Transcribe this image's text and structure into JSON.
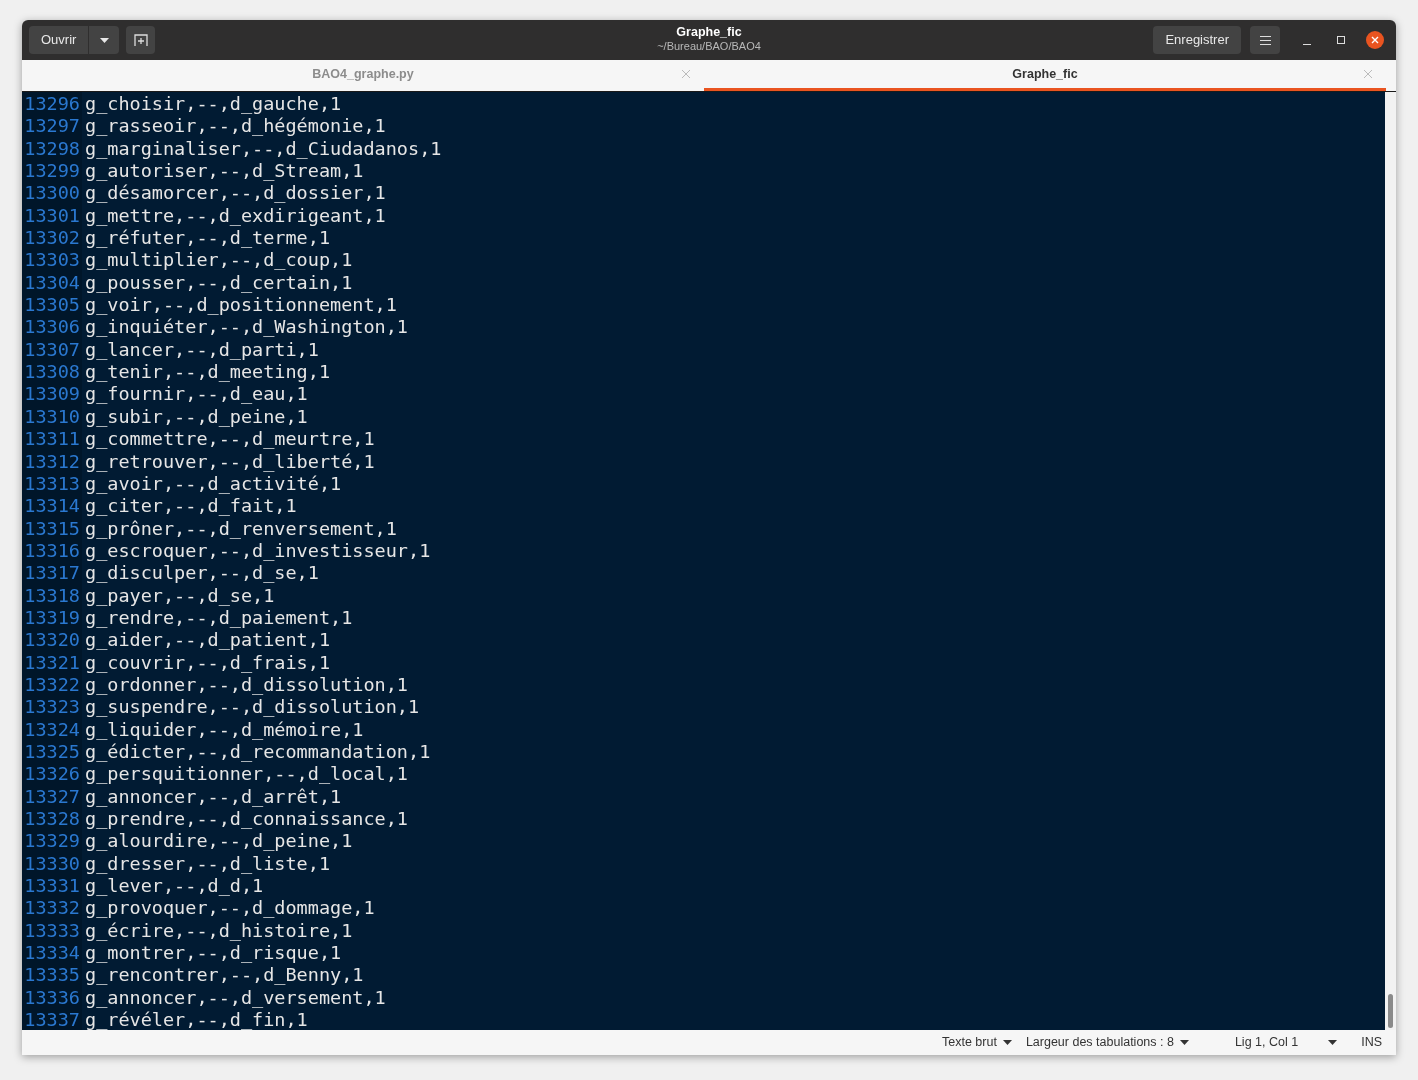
{
  "header": {
    "open_button": "Ouvrir",
    "title": "Graphe_fic",
    "subtitle": "~/Bureau/BAO/BAO4",
    "save_button": "Enregistrer"
  },
  "tabs": [
    {
      "label": "BAO4_graphe.py",
      "selected": false
    },
    {
      "label": "Graphe_fic",
      "selected": true
    }
  ],
  "lines": [
    {
      "number": "13296",
      "text": "g_choisir,--,d_gauche,1"
    },
    {
      "number": "13297",
      "text": "g_rasseoir,--,d_hégémonie,1"
    },
    {
      "number": "13298",
      "text": "g_marginaliser,--,d_Ciudadanos,1"
    },
    {
      "number": "13299",
      "text": "g_autoriser,--,d_Stream,1"
    },
    {
      "number": "13300",
      "text": "g_désamorcer,--,d_dossier,1"
    },
    {
      "number": "13301",
      "text": "g_mettre,--,d_exdirigeant,1"
    },
    {
      "number": "13302",
      "text": "g_réfuter,--,d_terme,1"
    },
    {
      "number": "13303",
      "text": "g_multiplier,--,d_coup,1"
    },
    {
      "number": "13304",
      "text": "g_pousser,--,d_certain,1"
    },
    {
      "number": "13305",
      "text": "g_voir,--,d_positionnement,1"
    },
    {
      "number": "13306",
      "text": "g_inquiéter,--,d_Washington,1"
    },
    {
      "number": "13307",
      "text": "g_lancer,--,d_parti,1"
    },
    {
      "number": "13308",
      "text": "g_tenir,--,d_meeting,1"
    },
    {
      "number": "13309",
      "text": "g_fournir,--,d_eau,1"
    },
    {
      "number": "13310",
      "text": "g_subir,--,d_peine,1"
    },
    {
      "number": "13311",
      "text": "g_commettre,--,d_meurtre,1"
    },
    {
      "number": "13312",
      "text": "g_retrouver,--,d_liberté,1"
    },
    {
      "number": "13313",
      "text": "g_avoir,--,d_activité,1"
    },
    {
      "number": "13314",
      "text": "g_citer,--,d_fait,1"
    },
    {
      "number": "13315",
      "text": "g_prôner,--,d_renversement,1"
    },
    {
      "number": "13316",
      "text": "g_escroquer,--,d_investisseur,1"
    },
    {
      "number": "13317",
      "text": "g_disculper,--,d_se,1"
    },
    {
      "number": "13318",
      "text": "g_payer,--,d_se,1"
    },
    {
      "number": "13319",
      "text": "g_rendre,--,d_paiement,1"
    },
    {
      "number": "13320",
      "text": "g_aider,--,d_patient,1"
    },
    {
      "number": "13321",
      "text": "g_couvrir,--,d_frais,1"
    },
    {
      "number": "13322",
      "text": "g_ordonner,--,d_dissolution,1"
    },
    {
      "number": "13323",
      "text": "g_suspendre,--,d_dissolution,1"
    },
    {
      "number": "13324",
      "text": "g_liquider,--,d_mémoire,1"
    },
    {
      "number": "13325",
      "text": "g_édicter,--,d_recommandation,1"
    },
    {
      "number": "13326",
      "text": "g_persquitionner,--,d_local,1"
    },
    {
      "number": "13327",
      "text": "g_annoncer,--,d_arrêt,1"
    },
    {
      "number": "13328",
      "text": "g_prendre,--,d_connaissance,1"
    },
    {
      "number": "13329",
      "text": "g_alourdire,--,d_peine,1"
    },
    {
      "number": "13330",
      "text": "g_dresser,--,d_liste,1"
    },
    {
      "number": "13331",
      "text": "g_lever,--,d_d,1"
    },
    {
      "number": "13332",
      "text": "g_provoquer,--,d_dommage,1"
    },
    {
      "number": "13333",
      "text": "g_écrire,--,d_histoire,1"
    },
    {
      "number": "13334",
      "text": "g_montrer,--,d_risque,1"
    },
    {
      "number": "13335",
      "text": "g_rencontrer,--,d_Benny,1"
    },
    {
      "number": "13336",
      "text": "g_annoncer,--,d_versement,1"
    },
    {
      "number": "13337",
      "text": "g_révéler,--,d_fin,1"
    }
  ],
  "status_bar": {
    "syntax": "Texte brut",
    "tab_width": "Largeur des tabulations : 8",
    "position": "Lig 1, Col 1",
    "mode": "INS"
  }
}
